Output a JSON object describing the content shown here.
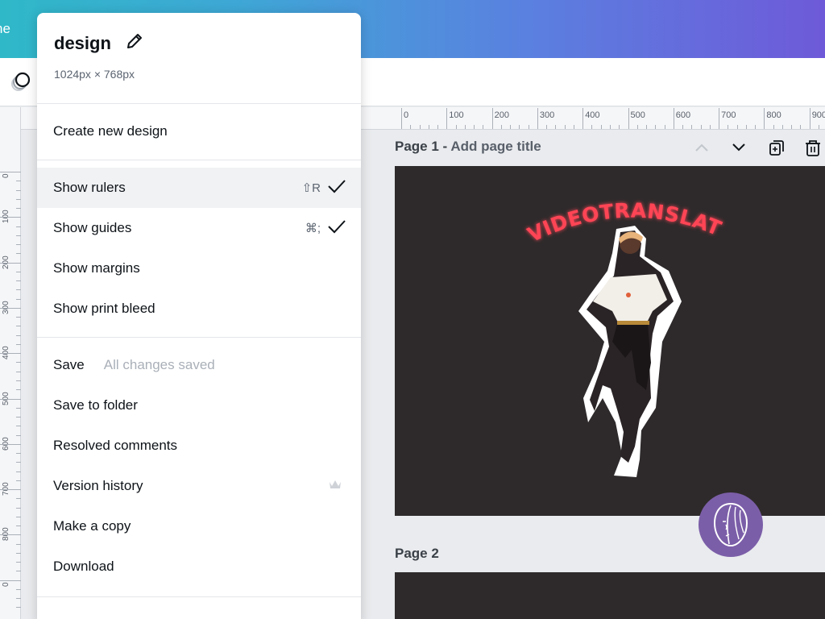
{
  "topbar": {
    "home_label": "ne"
  },
  "ruler": {
    "horizontal_labels": [
      "0",
      "100",
      "200",
      "300",
      "400",
      "500",
      "600",
      "700",
      "800",
      "900"
    ],
    "vertical_labels": [
      "0",
      "100",
      "200",
      "300",
      "400",
      "500",
      "600",
      "700",
      "800",
      "0"
    ]
  },
  "canvas": {
    "page1_label": "Page 1",
    "page1_title_placeholder": "Add page title",
    "page1_text": "VIDEOTRANSLATOR",
    "page2_label": "Page 2",
    "accent_neon": "#ff3b4e",
    "page_bg": "#2e2a2b"
  },
  "menu": {
    "title": "design",
    "dimensions": "1024px × 768px",
    "create_new": "Create new design",
    "items_view": [
      {
        "label": "Show rulers",
        "shortcut": "⇧R",
        "checked": true
      },
      {
        "label": "Show guides",
        "shortcut": "⌘;",
        "checked": true
      },
      {
        "label": "Show margins"
      },
      {
        "label": "Show print bleed"
      }
    ],
    "save": {
      "label": "Save",
      "status": "All changes saved"
    },
    "save_to_folder": "Save to folder",
    "resolved_comments": "Resolved comments",
    "version_history": "Version history",
    "make_copy": "Make a copy",
    "download": "Download"
  },
  "colors": {
    "gradient_start": "#2fb8c8",
    "gradient_end": "#6e5ad8",
    "avatar": "#7b5ea8"
  }
}
